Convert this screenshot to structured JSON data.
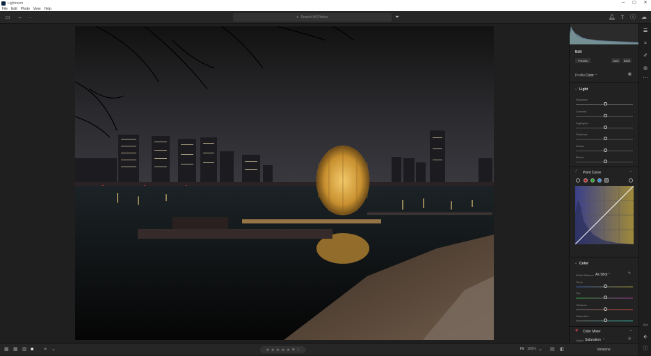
{
  "app": {
    "title": "Lightroom"
  },
  "menu": [
    "File",
    "Edit",
    "Photo",
    "View",
    "Help"
  ],
  "window_controls": {
    "minimize": "─",
    "maximize": "▢",
    "close": "✕"
  },
  "search": {
    "placeholder": "Search All Photos"
  },
  "panel": {
    "edit_title": "Edit",
    "presets_label": "Presets",
    "auto_label": "Auto",
    "bw_label": "B&W",
    "profile_label": "Profile",
    "profile_value": "Color",
    "light_header": "Light",
    "light_sliders": [
      {
        "label": "Exposure",
        "value": 0.5
      },
      {
        "label": "Contrast",
        "value": 0.5
      },
      {
        "label": "Highlights",
        "value": 0.5
      },
      {
        "label": "Shadows",
        "value": 0.5
      },
      {
        "label": "Whites",
        "value": 0.5
      },
      {
        "label": "Blacks",
        "value": 0.5
      }
    ],
    "point_curve_label": "Point Curve",
    "color_header": "Color",
    "white_balance_label": "White Balance",
    "white_balance_value": "As Shot",
    "color_sliders": [
      {
        "label": "Temp",
        "value": 0.5
      },
      {
        "label": "Tint",
        "value": 0.5
      },
      {
        "label": "Vibrance",
        "value": 0.5
      },
      {
        "label": "Saturation",
        "value": 0.5
      }
    ],
    "color_mixer_label": "Color Mixer",
    "adjust_label": "Adjust",
    "adjust_value": "Saturation"
  },
  "bottom": {
    "fit": "Fit",
    "zoom": "100%",
    "versions": "Versions"
  },
  "colors": {
    "accent": "#2d8ceb",
    "panel": "#222222",
    "viewer": "#1f1f1f"
  }
}
